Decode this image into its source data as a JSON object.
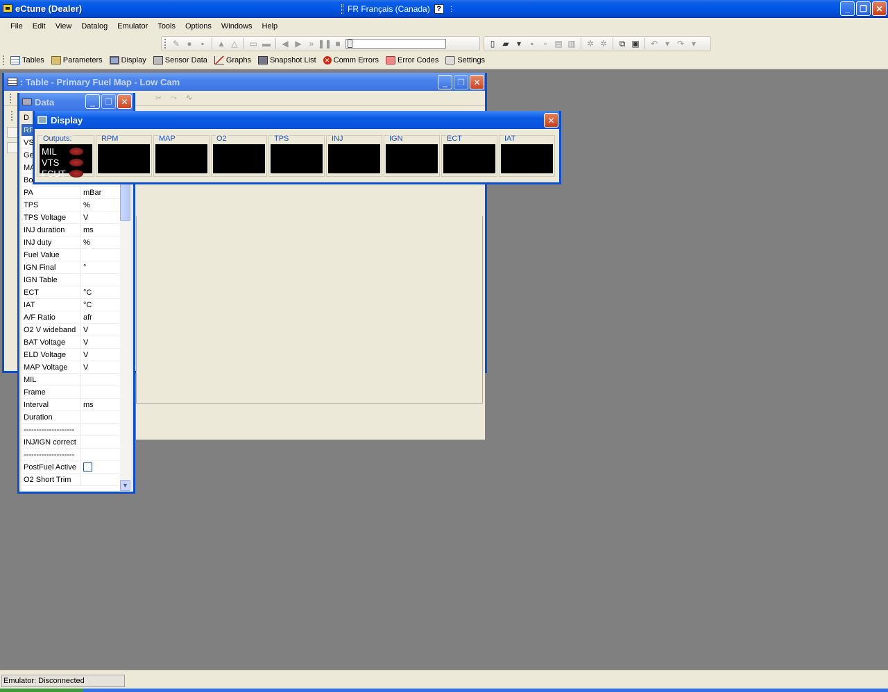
{
  "app": {
    "title": "eCtune (Dealer)",
    "language": "FR Français (Canada)",
    "help_label": "?",
    "minimize_glyph": "_",
    "restore_glyph": "❐",
    "close_glyph": "✕"
  },
  "menubar": {
    "items": [
      "File",
      "Edit",
      "View",
      "Datalog",
      "Emulator",
      "Tools",
      "Options",
      "Windows",
      "Help"
    ]
  },
  "toolbar2": {
    "items": [
      {
        "label": "Tables",
        "icon": "table-icon"
      },
      {
        "label": "Parameters",
        "icon": "parameters-icon"
      },
      {
        "label": "Display",
        "icon": "monitor-icon"
      },
      {
        "label": "Sensor Data",
        "icon": "sensor-icon"
      },
      {
        "label": "Graphs",
        "icon": "graph-icon"
      },
      {
        "label": "Snapshot List",
        "icon": "camera-icon"
      },
      {
        "label": "Comm Errors",
        "icon": "error-icon"
      },
      {
        "label": "Error Codes",
        "icon": "engine-icon"
      },
      {
        "label": "Settings",
        "icon": "settings-icon"
      }
    ]
  },
  "table_window": {
    "title": ": Table - Primary Fuel Map - Low Cam"
  },
  "data_window": {
    "title": "Data",
    "hidden_partial": [
      "D",
      "RP",
      "VS",
      "Ge",
      "MA",
      "Bo"
    ],
    "rows": [
      {
        "name": "PA",
        "unit": "mBar"
      },
      {
        "name": "TPS",
        "unit": "%"
      },
      {
        "name": "TPS Voltage",
        "unit": "V"
      },
      {
        "name": "INJ duration",
        "unit": "ms"
      },
      {
        "name": "INJ duty",
        "unit": "%"
      },
      {
        "name": "Fuel Value",
        "unit": ""
      },
      {
        "name": "IGN Final",
        "unit": "°"
      },
      {
        "name": "IGN Table",
        "unit": ""
      },
      {
        "name": "ECT",
        "unit": "°C"
      },
      {
        "name": "IAT",
        "unit": "°C"
      },
      {
        "name": "A/F Ratio",
        "unit": "afr"
      },
      {
        "name": "O2 V wideband",
        "unit": "V"
      },
      {
        "name": "BAT Voltage",
        "unit": "V"
      },
      {
        "name": "ELD Voltage",
        "unit": "V"
      },
      {
        "name": "MAP Voltage",
        "unit": "V"
      },
      {
        "name": "MIL",
        "unit": ""
      },
      {
        "name": "Frame",
        "unit": ""
      },
      {
        "name": "Interval",
        "unit": "ms"
      },
      {
        "name": "Duration",
        "unit": ""
      },
      {
        "name": "--------------------",
        "unit": ""
      },
      {
        "name": "INJ/IGN correct",
        "unit": ""
      },
      {
        "name": "--------------------",
        "unit": ""
      },
      {
        "name": "PostFuel Active",
        "unit": "",
        "checkbox": true
      },
      {
        "name": "O2 Short Trim",
        "unit": ""
      }
    ]
  },
  "display_window": {
    "title": "Display",
    "outputs_label": "Outputs:",
    "outputs": [
      "MIL",
      "VTS",
      "FCUT"
    ],
    "gauges": [
      "RPM",
      "MAP",
      "O2",
      "TPS",
      "INJ",
      "IGN",
      "ECT",
      "IAT"
    ]
  },
  "status": {
    "text": "Emulator: Disconnected"
  }
}
